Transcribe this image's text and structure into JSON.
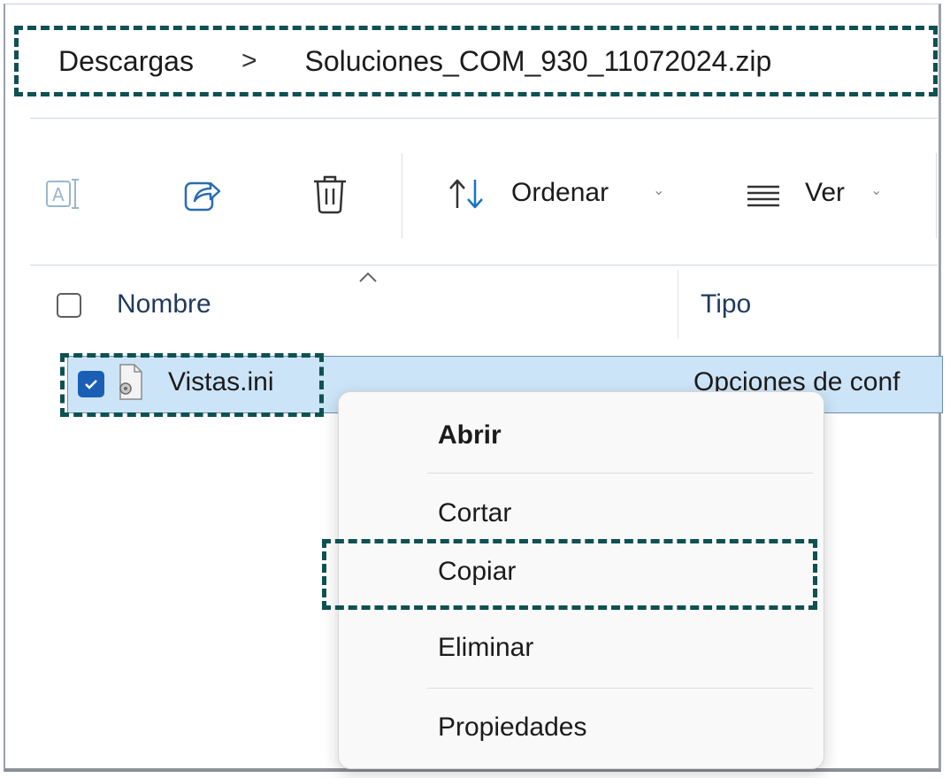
{
  "breadcrumb": {
    "parent": "Descargas",
    "separator": ">",
    "current": "Soluciones_COM_930_11072024.zip"
  },
  "toolbar": {
    "rename_icon": "rename-icon",
    "share_icon": "share-icon",
    "delete_icon": "trash-icon",
    "sort_label": "Ordenar",
    "sort_icon": "sort-arrows-icon",
    "view_label": "Ver",
    "view_icon": "list-lines-icon",
    "chevron": "⌄"
  },
  "columns": {
    "name": "Nombre",
    "type": "Tipo",
    "sort_indicator": "^"
  },
  "rows": [
    {
      "name": "Vistas.ini",
      "type": "Opciones de conf",
      "selected": true
    }
  ],
  "context_menu": {
    "items": [
      {
        "label": "Abrir"
      },
      {
        "label": "Cortar"
      },
      {
        "label": "Copiar"
      },
      {
        "label": "Eliminar"
      },
      {
        "label": "Propiedades"
      }
    ]
  },
  "colors": {
    "highlight_dash": "#0f5151",
    "selection": "#cce4f7",
    "checkbox_checked": "#1a5fb4",
    "sort_icon_blue": "#1a73c8"
  }
}
